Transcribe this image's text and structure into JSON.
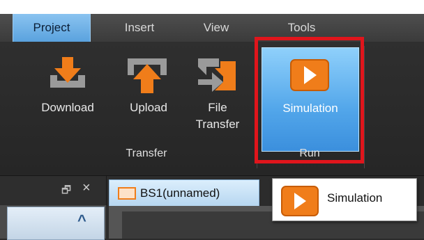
{
  "tabs": [
    {
      "label": "Project",
      "active": true
    },
    {
      "label": "Insert",
      "active": false
    },
    {
      "label": "View",
      "active": false
    },
    {
      "label": "Tools",
      "active": false
    }
  ],
  "ribbon": {
    "transfer": {
      "group_label": "Transfer",
      "download": {
        "label": "Download",
        "icon": "download-icon"
      },
      "upload": {
        "label": "Upload",
        "icon": "upload-icon"
      },
      "file_transfer": {
        "line1": "File",
        "line2": "Transfer",
        "icon": "file-transfer-icon"
      }
    },
    "run": {
      "group_label": "Run",
      "simulation": {
        "label": "Simulation",
        "icon": "play-icon"
      }
    }
  },
  "panel": {
    "restore_glyph": "🗗",
    "close_glyph": "×",
    "collapse_glyph": "^"
  },
  "document_tab": {
    "label": "BS1(unnamed)"
  },
  "tooltip": {
    "label": "Simulation"
  },
  "colors": {
    "accent_blue": "#5aa2de",
    "orange": "#f07d1a",
    "highlight_red": "#e0151c"
  }
}
